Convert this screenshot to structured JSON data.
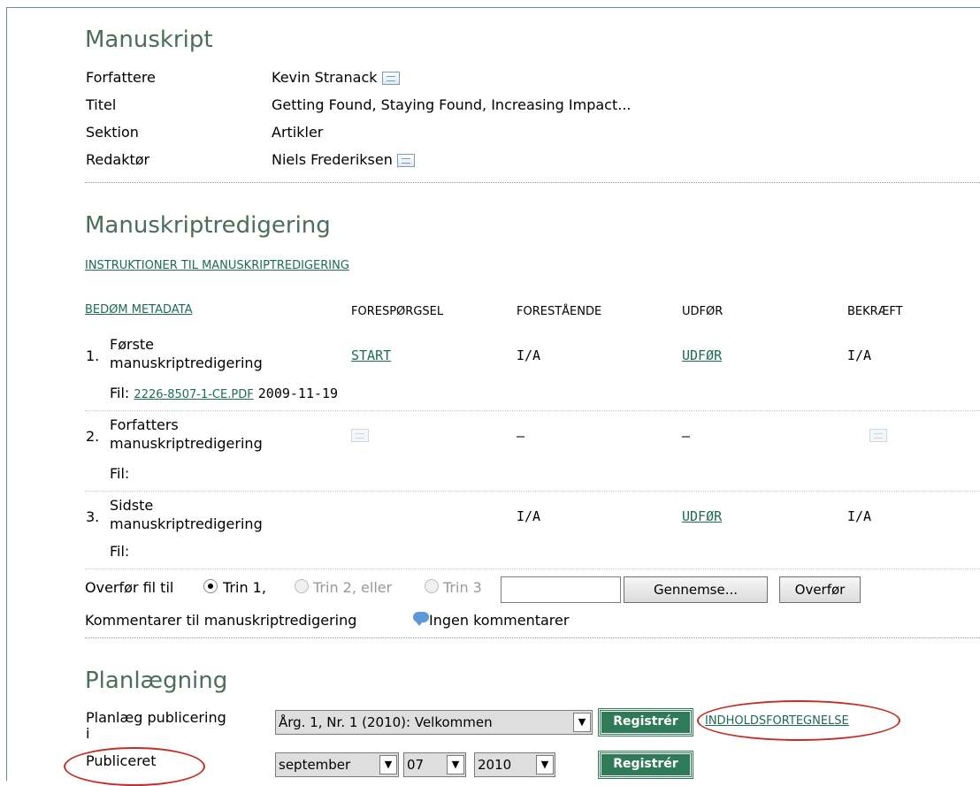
{
  "summary": {
    "heading": "Manuskript",
    "rows": [
      {
        "label": "Forfattere",
        "value": "Kevin Stranack"
      },
      {
        "label": "Titel",
        "value": "Getting Found, Staying Found, Increasing Impact..."
      },
      {
        "label": "Sektion",
        "value": "Artikler"
      },
      {
        "label": "Redaktør",
        "value": "Niels Frederiksen"
      }
    ]
  },
  "copyedit": {
    "heading": "Manuskriptredigering",
    "instructions_link": "INSTRUKTIONER TIL MANUSKRIPTREDIGERING",
    "review_metadata_link": "BEDØM METADATA",
    "columns": [
      "FORESPØRGSEL",
      "FORESTÅENDE",
      "UDFØR",
      "BEKRÆFT"
    ],
    "steps": [
      {
        "num": "1.",
        "title_line1": "Første",
        "title_line2": "manuskriptredigering",
        "request": "START",
        "underway": "I/A",
        "complete": "UDFØR",
        "acknowledge": "I/A",
        "file_label": "Fil:",
        "file_link": "2226-8507-1-CE.PDF",
        "file_date": "2009-11-19"
      },
      {
        "num": "2.",
        "title_line1": "Forfatters",
        "title_line2": "manuskriptredigering",
        "request": "",
        "underway": "—",
        "complete": "—",
        "acknowledge": "",
        "file_label": "Fil:"
      },
      {
        "num": "3.",
        "title_line1": "Sidste",
        "title_line2": "manuskriptredigering",
        "request": "",
        "underway": "I/A",
        "complete": "UDFØR",
        "acknowledge": "I/A",
        "file_label": "Fil:"
      }
    ],
    "upload": {
      "label": "Overfør fil til",
      "options": [
        "Trin 1,",
        "Trin 2, eller",
        "Trin 3"
      ],
      "selected": "Trin 1,",
      "browse_label": "Gennemse...",
      "upload_label": "Overfør"
    },
    "comments_label": "Kommentarer til manuskriptredigering",
    "comments_value": "Ingen kommentarer"
  },
  "scheduling": {
    "heading": "Planlægning",
    "schedule_label_line1": "Planlæg publicering",
    "schedule_label_line2": "i",
    "issue_value": "Årg. 1, Nr. 1 (2010): Velkommen",
    "register_label": "Registrér",
    "toc_link": "INDHOLDSFORTEGNELSE",
    "published_label": "Publiceret",
    "month": "september",
    "day": "07",
    "year": "2010"
  },
  "colors": {
    "heading": "#4b6e5a",
    "link": "#1d6c52",
    "button_green": "#2f7a57",
    "annotation_red": "#c0302a"
  }
}
